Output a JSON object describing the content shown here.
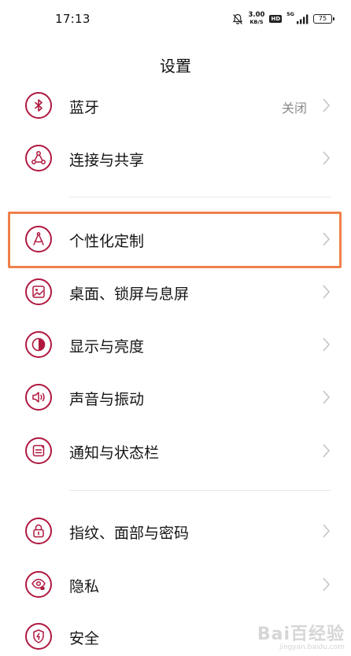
{
  "status_bar": {
    "time": "17:13",
    "net_speed": "3.00",
    "net_speed_unit": "KB/S",
    "hd_label": "HD",
    "network_type": "5G",
    "battery": "75"
  },
  "header": {
    "title": "设置"
  },
  "groups": [
    {
      "items": [
        {
          "label": "蓝牙",
          "value": "关闭",
          "icon": "bluetooth-icon"
        },
        {
          "label": "连接与共享",
          "icon": "share-icon"
        }
      ]
    },
    {
      "items": [
        {
          "label": "个性化定制",
          "icon": "compass-icon",
          "highlighted": true
        },
        {
          "label": "桌面、锁屏与息屏",
          "icon": "wallpaper-icon"
        },
        {
          "label": "显示与亮度",
          "icon": "brightness-icon"
        },
        {
          "label": "声音与振动",
          "icon": "speaker-icon"
        },
        {
          "label": "通知与状态栏",
          "icon": "notification-icon"
        }
      ]
    },
    {
      "items": [
        {
          "label": "指纹、面部与密码",
          "icon": "lock-icon"
        },
        {
          "label": "隐私",
          "icon": "privacy-eye-icon"
        },
        {
          "label": "安全",
          "icon": "shield-icon"
        }
      ]
    }
  ],
  "colors": {
    "icon_accent": "#b0183f",
    "highlight_border": "#f0804a",
    "chevron": "#c4c4c4"
  },
  "watermark": {
    "main": "Bai百经验",
    "sub": "jingyan.baidu.com"
  }
}
